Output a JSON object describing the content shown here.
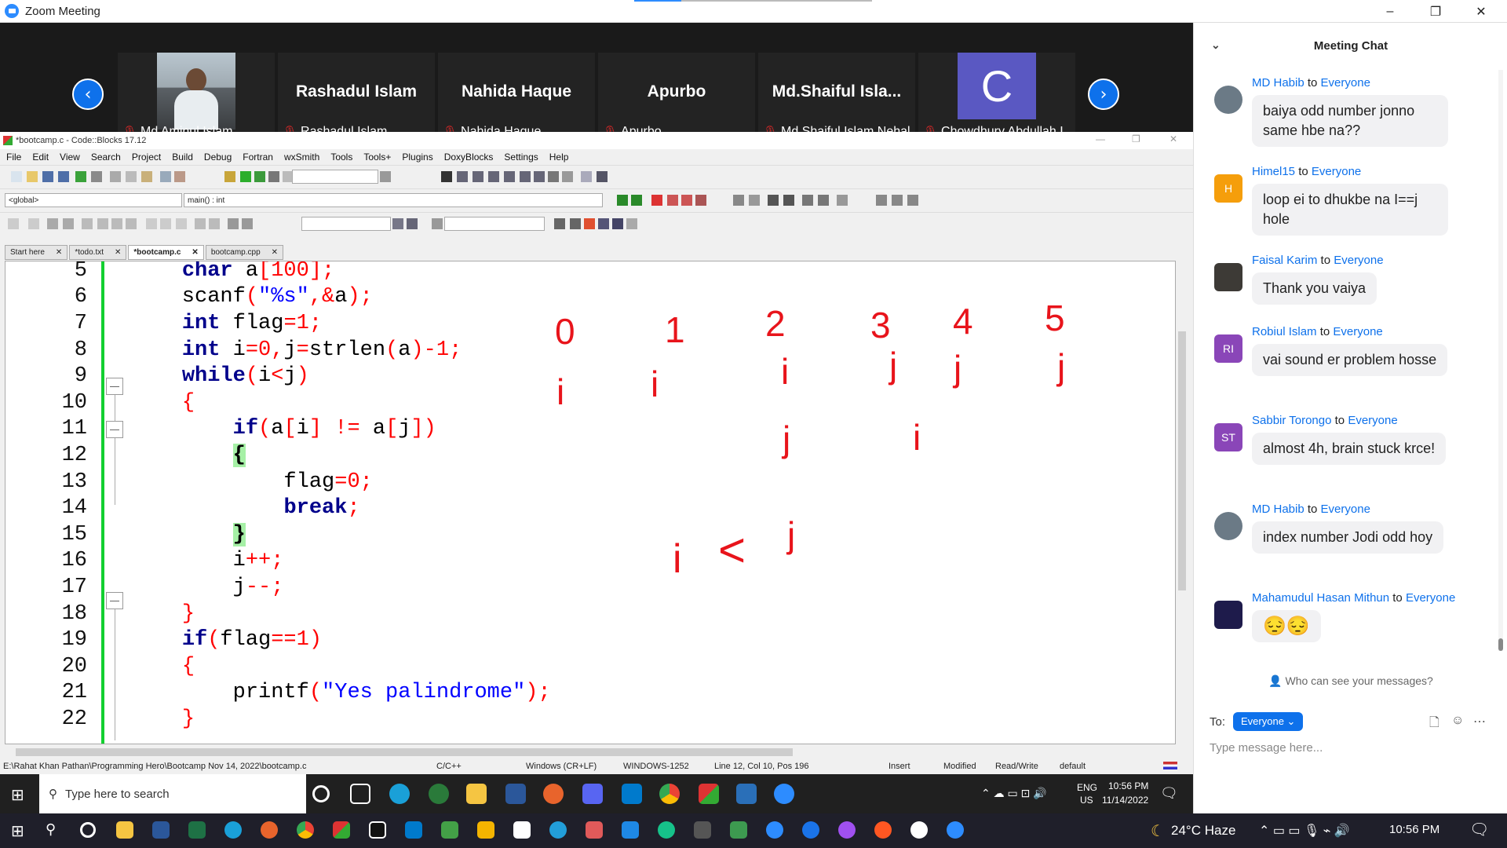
{
  "window": {
    "title": "Zoom Meeting",
    "min": "–",
    "max": "❐",
    "close": "✕"
  },
  "participants": [
    {
      "display": "",
      "label": "Md Aminul Islam",
      "avatar": "photo"
    },
    {
      "display": "Rashadul Islam",
      "label": "Rashadul Islam"
    },
    {
      "display": "Nahida Haque",
      "label": "Nahida Haque"
    },
    {
      "display": "Apurbo",
      "label": "Apurbo"
    },
    {
      "display": "Md.Shaiful  Isla...",
      "label": "Md.Shaiful Islam Nehal"
    },
    {
      "display": "C",
      "label": "Chowdhury Abdullah I..."
    }
  ],
  "codeblocks": {
    "title": "*bootcamp.c - Code::Blocks 17.12",
    "menu": [
      "File",
      "Edit",
      "View",
      "Search",
      "Project",
      "Build",
      "Debug",
      "Fortran",
      "wxSmith",
      "Tools",
      "Tools+",
      "Plugins",
      "DoxyBlocks",
      "Settings",
      "Help"
    ],
    "scope_combo": "<global>",
    "func_combo": "main() : int",
    "tabs": [
      "Start here",
      "*todo.txt",
      "*bootcamp.c",
      "bootcamp.cpp"
    ],
    "active_tab": 2,
    "line_numbers": [
      "5",
      "6",
      "7",
      "8",
      "9",
      "10",
      "11",
      "12",
      "13",
      "14",
      "15",
      "16",
      "17",
      "18",
      "19",
      "20",
      "21",
      "22"
    ],
    "status": {
      "path": "E:\\Rahat Khan Pathan\\Programming Hero\\Bootcamp Nov 14, 2022\\bootcamp.c",
      "lang": "C/C++",
      "eol": "Windows (CR+LF)",
      "encoding": "WINDOWS-1252",
      "pos": "Line 12, Col 10, Pos 196",
      "mode": "Insert",
      "modified": "Modified",
      "rw": "Read/Write",
      "profile": "default"
    }
  },
  "annotations": {
    "top_numbers": [
      "0",
      "1",
      "2",
      "3",
      "4",
      "5"
    ],
    "index_marks": [
      "i",
      "i",
      "i",
      "j",
      "j",
      "j",
      "j",
      "i",
      "i",
      "<",
      "j"
    ]
  },
  "taskbar_inner": {
    "search": "Type here to search",
    "lang1": "ENG",
    "lang2": "US",
    "time": "10:56 PM",
    "date": "11/14/2022"
  },
  "taskbar_outer": {
    "weather": "24°C  Haze",
    "time": "10:56 PM"
  },
  "chat": {
    "title": "Meeting Chat",
    "to_word": "to",
    "messages": [
      {
        "sender": "MD Habib",
        "target": "Everyone",
        "text": "baiya odd number jonno same hbe na??",
        "avatar": "",
        "color": "#6b7a86"
      },
      {
        "sender": "Himel15",
        "target": "Everyone",
        "text": "loop ei to dhukbe na I==j hole",
        "avatar": "H",
        "color": "#f59e0b"
      },
      {
        "sender": "Faisal Karim",
        "target": "Everyone",
        "text": "Thank you vaiya",
        "avatar": "",
        "color": "#3d3a36"
      },
      {
        "sender": "Robiul Islam",
        "target": "Everyone",
        "text": "vai sound er problem hosse",
        "avatar": "RI",
        "color": "#8a46b8"
      },
      {
        "sender": "Sabbir Torongo",
        "target": "Everyone",
        "text": "almost 4h, brain stuck krce!",
        "avatar": "ST",
        "color": "#8a46b8"
      },
      {
        "sender": "MD Habib",
        "target": "Everyone",
        "text": "index number Jodi odd hoy",
        "avatar": "",
        "color": "#6b7a86"
      },
      {
        "sender": "Mahamudul Hasan Mithun",
        "target": "Everyone",
        "text": "😔😔",
        "avatar": "",
        "color": "#1e1b4b"
      }
    ],
    "who_can_see": "Who can see your messages?",
    "to_label": "To:",
    "to_value": "Everyone",
    "placeholder": "Type message here..."
  }
}
